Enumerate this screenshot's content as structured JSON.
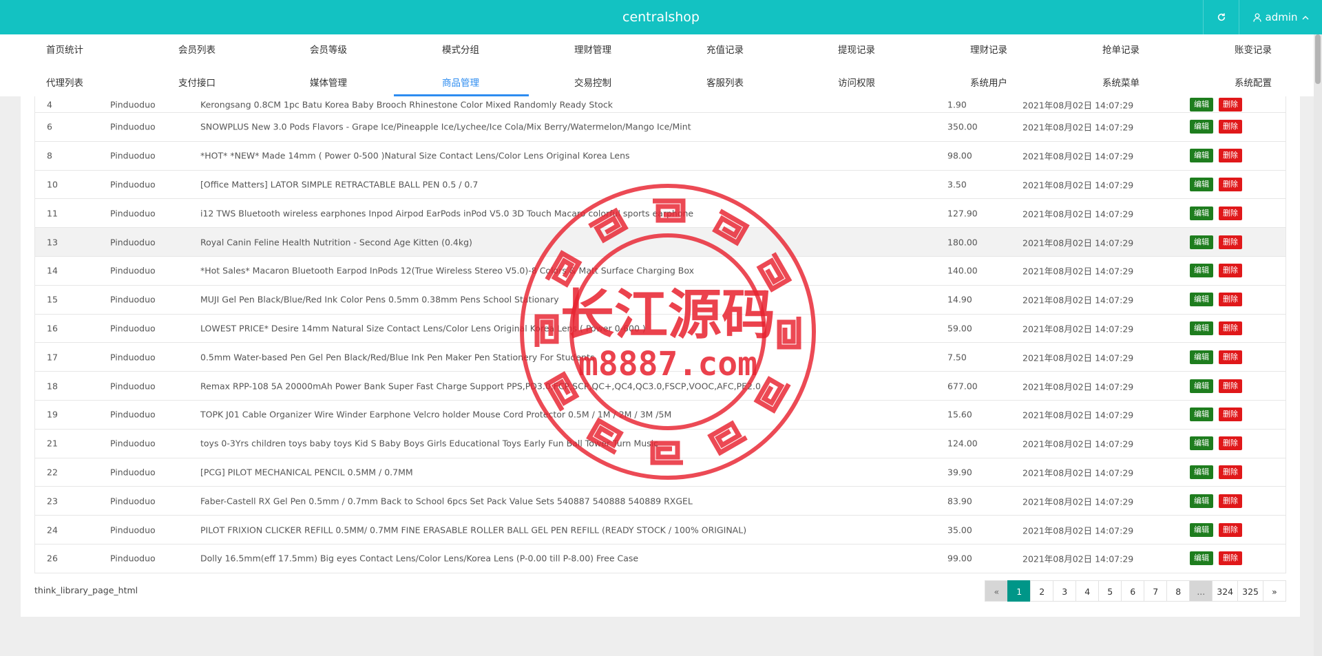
{
  "app": {
    "title": "centralshop",
    "user": "admin",
    "accent_color": "#13c2c2",
    "icons": {
      "refresh": "refresh-icon",
      "user": "user-icon",
      "chevron": "chevron-up-icon"
    }
  },
  "nav": {
    "row1": [
      "首页统计",
      "会员列表",
      "会员等级",
      "模式分组",
      "理财管理",
      "充值记录",
      "提现记录",
      "理财记录",
      "抢单记录",
      "账变记录"
    ],
    "row2": [
      "代理列表",
      "支付接口",
      "媒体管理",
      "商品管理",
      "交易控制",
      "客服列表",
      "访问权限",
      "系统用户",
      "系统菜单",
      "系统配置"
    ],
    "active": "商品管理"
  },
  "table": {
    "edit_label": "编辑",
    "delete_label": "删除",
    "rows": [
      {
        "id": "4",
        "shop": "Pinduoduo",
        "name": "Kerongsang 0.8CM 1pc Batu Korea Baby Brooch Rhinestone Color Mixed Randomly Ready Stock",
        "price": "1.90",
        "time": "2021年08月02日 14:07:29"
      },
      {
        "id": "6",
        "shop": "Pinduoduo",
        "name": "SNOWPLUS New 3.0 Pods Flavors - Grape Ice/Pineapple Ice/Lychee/Ice Cola/Mix Berry/Watermelon/Mango Ice/Mint",
        "price": "350.00",
        "time": "2021年08月02日 14:07:29"
      },
      {
        "id": "8",
        "shop": "Pinduoduo",
        "name": "*HOT* *NEW* Made 14mm ( Power 0-500 )Natural Size Contact Lens/Color Lens Original Korea Lens",
        "price": "98.00",
        "time": "2021年08月02日 14:07:29"
      },
      {
        "id": "10",
        "shop": "Pinduoduo",
        "name": "[Office Matters] LATOR SIMPLE RETRACTABLE BALL PEN 0.5 / 0.7",
        "price": "3.50",
        "time": "2021年08月02日 14:07:29"
      },
      {
        "id": "11",
        "shop": "Pinduoduo",
        "name": "i12 TWS Bluetooth wireless earphones Inpod Airpod EarPods inPod V5.0 3D Touch Macaro colorful sports earphone",
        "price": "127.90",
        "time": "2021年08月02日 14:07:29"
      },
      {
        "id": "13",
        "shop": "Pinduoduo",
        "name": "Royal Canin Feline Health Nutrition - Second Age Kitten (0.4kg)",
        "price": "180.00",
        "time": "2021年08月02日 14:07:29"
      },
      {
        "id": "14",
        "shop": "Pinduoduo",
        "name": "*Hot Sales* Macaron Bluetooth Earpod InPods 12(True Wireless Stereo V5.0)-8 Colors & Matt Surface Charging Box",
        "price": "140.00",
        "time": "2021年08月02日 14:07:29"
      },
      {
        "id": "15",
        "shop": "Pinduoduo",
        "name": "MUJI Gel Pen Black/Blue/Red Ink Color Pens 0.5mm 0.38mm Pens School Stationary",
        "price": "14.90",
        "time": "2021年08月02日 14:07:29"
      },
      {
        "id": "16",
        "shop": "Pinduoduo",
        "name": "LOWEST PRICE* Desire 14mm Natural Size Contact Lens/Color Lens Original Korea Lens ( Power 0-600 )",
        "price": "59.00",
        "time": "2021年08月02日 14:07:29"
      },
      {
        "id": "17",
        "shop": "Pinduoduo",
        "name": "0.5mm Water-based Pen Gel Pen Black/Red/Blue Ink Pen Maker Pen Stationery For Students",
        "price": "7.50",
        "time": "2021年08月02日 14:07:29"
      },
      {
        "id": "18",
        "shop": "Pinduoduo",
        "name": "Remax RPP-108 5A 20000mAh Power Bank Super Fast Charge Support PPS,PD3.0,FCP,SCP,QC+,QC4,QC3.0,FSCP,VOOC,AFC,PE2.0",
        "price": "677.00",
        "time": "2021年08月02日 14:07:29"
      },
      {
        "id": "19",
        "shop": "Pinduoduo",
        "name": "TOPK J01 Cable Organizer Wire Winder Earphone Velcro holder Mouse Cord Protector 0.5M / 1M / 2M / 3M /5M",
        "price": "15.60",
        "time": "2021年08月02日 14:07:29"
      },
      {
        "id": "21",
        "shop": "Pinduoduo",
        "name": "toys 0-3Yrs children toys baby toys Kid S Baby Boys Girls Educational Toys Early Fun Ball Tower Turn Music",
        "price": "124.00",
        "time": "2021年08月02日 14:07:29"
      },
      {
        "id": "22",
        "shop": "Pinduoduo",
        "name": "[PCG] PILOT MECHANICAL PENCIL 0.5MM / 0.7MM",
        "price": "39.90",
        "time": "2021年08月02日 14:07:29"
      },
      {
        "id": "23",
        "shop": "Pinduoduo",
        "name": "Faber-Castell RX Gel Pen 0.5mm / 0.7mm Back to School 6pcs Set Pack Value Sets 540887 540888 540889 RXGEL",
        "price": "83.90",
        "time": "2021年08月02日 14:07:29"
      },
      {
        "id": "24",
        "shop": "Pinduoduo",
        "name": "PILOT FRIXION CLICKER REFILL 0.5MM/ 0.7MM FINE ERASABLE ROLLER BALL GEL PEN REFILL (READY STOCK / 100% ORIGINAL)",
        "price": "35.00",
        "time": "2021年08月02日 14:07:29"
      },
      {
        "id": "26",
        "shop": "Pinduoduo",
        "name": "Dolly 16.5mm(eff 17.5mm) Big eyes Contact Lens/Color Lens/Korea Lens (P-0.00 till P-8.00) Free Case",
        "price": "99.00",
        "time": "2021年08月02日 14:07:29"
      }
    ]
  },
  "footer_note": "think_library_page_html",
  "pagination": {
    "prev": "«",
    "next": "»",
    "pages": [
      "1",
      "2",
      "3",
      "4",
      "5",
      "6",
      "7",
      "8",
      "...",
      "324",
      "325"
    ],
    "current": "1"
  },
  "watermark": {
    "text_cn": "长江源码",
    "text_url": "m8887.com",
    "color": "#e8222f"
  }
}
